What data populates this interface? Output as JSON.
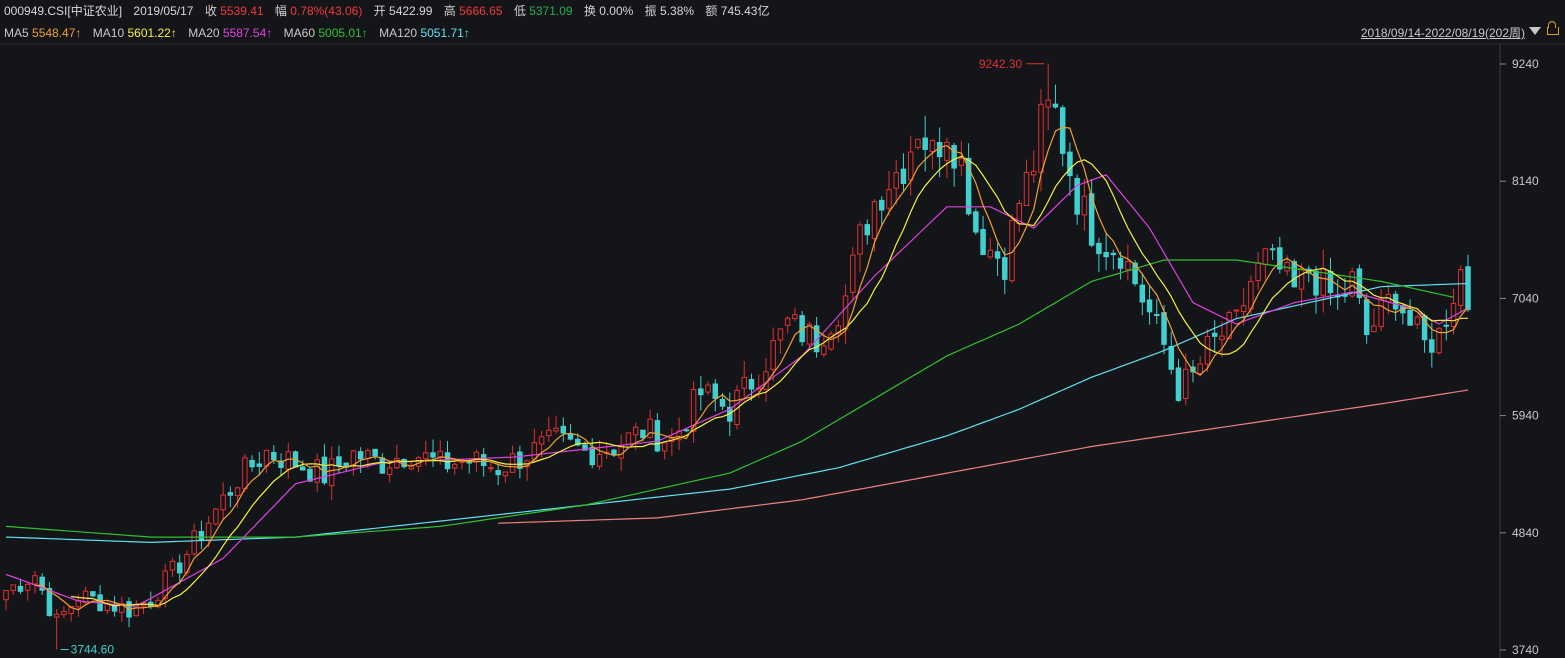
{
  "header": {
    "code": "000949.CSI[中证农业]",
    "date": "2019/05/17",
    "close_label": "收",
    "close": "5539.41",
    "change_label": "幅",
    "change": "0.78%(43.06)",
    "open_label": "开",
    "open": "5422.99",
    "high_label": "高",
    "high": "5666.65",
    "low_label": "低",
    "low": "5371.09",
    "turnover_label": "换",
    "turnover": "0.00%",
    "amplitude_label": "振",
    "amplitude": "5.38%",
    "amount_label": "额",
    "amount": "745.43亿"
  },
  "ma_legend": [
    {
      "name": "MA5",
      "value": "5548.47↑",
      "color": "#f0a030"
    },
    {
      "name": "MA10",
      "value": "5601.22↑",
      "color": "#f5f03c"
    },
    {
      "name": "MA20",
      "value": "5587.54↑",
      "color": "#e040e0"
    },
    {
      "name": "MA60",
      "value": "5005.01↑",
      "color": "#30c030"
    },
    {
      "name": "MA120",
      "value": "5051.71↑",
      "color": "#60e0f0"
    }
  ],
  "range_label": "2018/09/14-2022/08/19(202周)",
  "chart_data": {
    "type": "candlestick",
    "y_axis": {
      "ticks": [
        3740,
        4840,
        5940,
        7040,
        8140,
        9240
      ],
      "labels": [
        "3740",
        "4840",
        "5940",
        "7040",
        "8140",
        "9240"
      ],
      "min": 3740,
      "max": 9240,
      "position": "right"
    },
    "annotations": {
      "max_label": "9242.30",
      "max_value": 9242.3,
      "max_index": 144,
      "min_label": "3744.60",
      "min_value": 3744.6,
      "min_index": 7
    },
    "up_color": "#e03030",
    "down_color": "#40d0d0",
    "anchors": [
      [
        0,
        4300
      ],
      [
        4,
        4450
      ],
      [
        7,
        4000
      ],
      [
        10,
        4250
      ],
      [
        14,
        4180
      ],
      [
        17,
        4120
      ],
      [
        20,
        4220
      ],
      [
        24,
        4550
      ],
      [
        28,
        4950
      ],
      [
        32,
        5350
      ],
      [
        36,
        5600
      ],
      [
        40,
        5500
      ],
      [
        44,
        5380
      ],
      [
        48,
        5580
      ],
      [
        52,
        5500
      ],
      [
        56,
        5600
      ],
      [
        60,
        5480
      ],
      [
        64,
        5520
      ],
      [
        68,
        5450
      ],
      [
        72,
        5580
      ],
      [
        76,
        5700
      ],
      [
        80,
        5600
      ],
      [
        84,
        5650
      ],
      [
        88,
        5800
      ],
      [
        92,
        5700
      ],
      [
        96,
        6150
      ],
      [
        100,
        6000
      ],
      [
        104,
        6350
      ],
      [
        108,
        6800
      ],
      [
        112,
        6650
      ],
      [
        116,
        7050
      ],
      [
        118,
        7600
      ],
      [
        120,
        7950
      ],
      [
        122,
        8150
      ],
      [
        124,
        8300
      ],
      [
        126,
        8650
      ],
      [
        128,
        8400
      ],
      [
        130,
        8650
      ],
      [
        132,
        8300
      ],
      [
        134,
        7700
      ],
      [
        136,
        7500
      ],
      [
        138,
        7400
      ],
      [
        140,
        7950
      ],
      [
        142,
        8300
      ],
      [
        144,
        9050
      ],
      [
        146,
        8500
      ],
      [
        148,
        8000
      ],
      [
        150,
        7700
      ],
      [
        152,
        7550
      ],
      [
        154,
        7500
      ],
      [
        156,
        7200
      ],
      [
        158,
        6900
      ],
      [
        160,
        6600
      ],
      [
        162,
        6200
      ],
      [
        164,
        6300
      ],
      [
        166,
        6550
      ],
      [
        168,
        6700
      ],
      [
        170,
        6800
      ],
      [
        172,
        7200
      ],
      [
        174,
        7400
      ],
      [
        176,
        7300
      ],
      [
        178,
        7100
      ],
      [
        180,
        7300
      ],
      [
        182,
        7150
      ],
      [
        184,
        7000
      ],
      [
        186,
        7200
      ],
      [
        188,
        6700
      ],
      [
        190,
        6900
      ],
      [
        192,
        7100
      ],
      [
        194,
        6800
      ],
      [
        196,
        6600
      ],
      [
        198,
        6700
      ],
      [
        200,
        7100
      ],
      [
        201,
        7300
      ],
      [
        202,
        7000
      ]
    ],
    "ma60": {
      "start": 0,
      "points": [
        [
          0,
          4900
        ],
        [
          10,
          4850
        ],
        [
          20,
          4800
        ],
        [
          40,
          4800
        ],
        [
          60,
          4900
        ],
        [
          80,
          5100
        ],
        [
          100,
          5400
        ],
        [
          110,
          5700
        ],
        [
          120,
          6100
        ],
        [
          130,
          6500
        ],
        [
          140,
          6800
        ],
        [
          150,
          7200
        ],
        [
          160,
          7400
        ],
        [
          170,
          7400
        ],
        [
          180,
          7300
        ],
        [
          190,
          7200
        ],
        [
          200,
          7050
        ]
      ]
    },
    "ma120": {
      "points": [
        [
          0,
          4800
        ],
        [
          20,
          4750
        ],
        [
          40,
          4800
        ],
        [
          60,
          4950
        ],
        [
          80,
          5100
        ],
        [
          100,
          5250
        ],
        [
          115,
          5450
        ],
        [
          130,
          5750
        ],
        [
          140,
          6000
        ],
        [
          150,
          6300
        ],
        [
          160,
          6550
        ],
        [
          170,
          6850
        ],
        [
          180,
          7000
        ],
        [
          190,
          7150
        ],
        [
          202,
          7180
        ]
      ]
    },
    "ma250": {
      "start": 68,
      "points": [
        [
          68,
          4930
        ],
        [
          90,
          4980
        ],
        [
          110,
          5150
        ],
        [
          130,
          5400
        ],
        [
          150,
          5650
        ],
        [
          170,
          5850
        ],
        [
          190,
          6050
        ],
        [
          202,
          6180
        ]
      ]
    },
    "ma20": {
      "points": [
        [
          0,
          4450
        ],
        [
          10,
          4200
        ],
        [
          18,
          4150
        ],
        [
          30,
          4600
        ],
        [
          40,
          5300
        ],
        [
          52,
          5500
        ],
        [
          70,
          5550
        ],
        [
          90,
          5700
        ],
        [
          100,
          6000
        ],
        [
          110,
          6500
        ],
        [
          120,
          7250
        ],
        [
          130,
          7900
        ],
        [
          136,
          7900
        ],
        [
          142,
          7700
        ],
        [
          148,
          8100
        ],
        [
          152,
          8200
        ],
        [
          158,
          7700
        ],
        [
          164,
          7000
        ],
        [
          170,
          6800
        ],
        [
          178,
          7000
        ],
        [
          186,
          7100
        ],
        [
          194,
          6950
        ],
        [
          198,
          6800
        ],
        [
          202,
          6950
        ]
      ]
    }
  }
}
